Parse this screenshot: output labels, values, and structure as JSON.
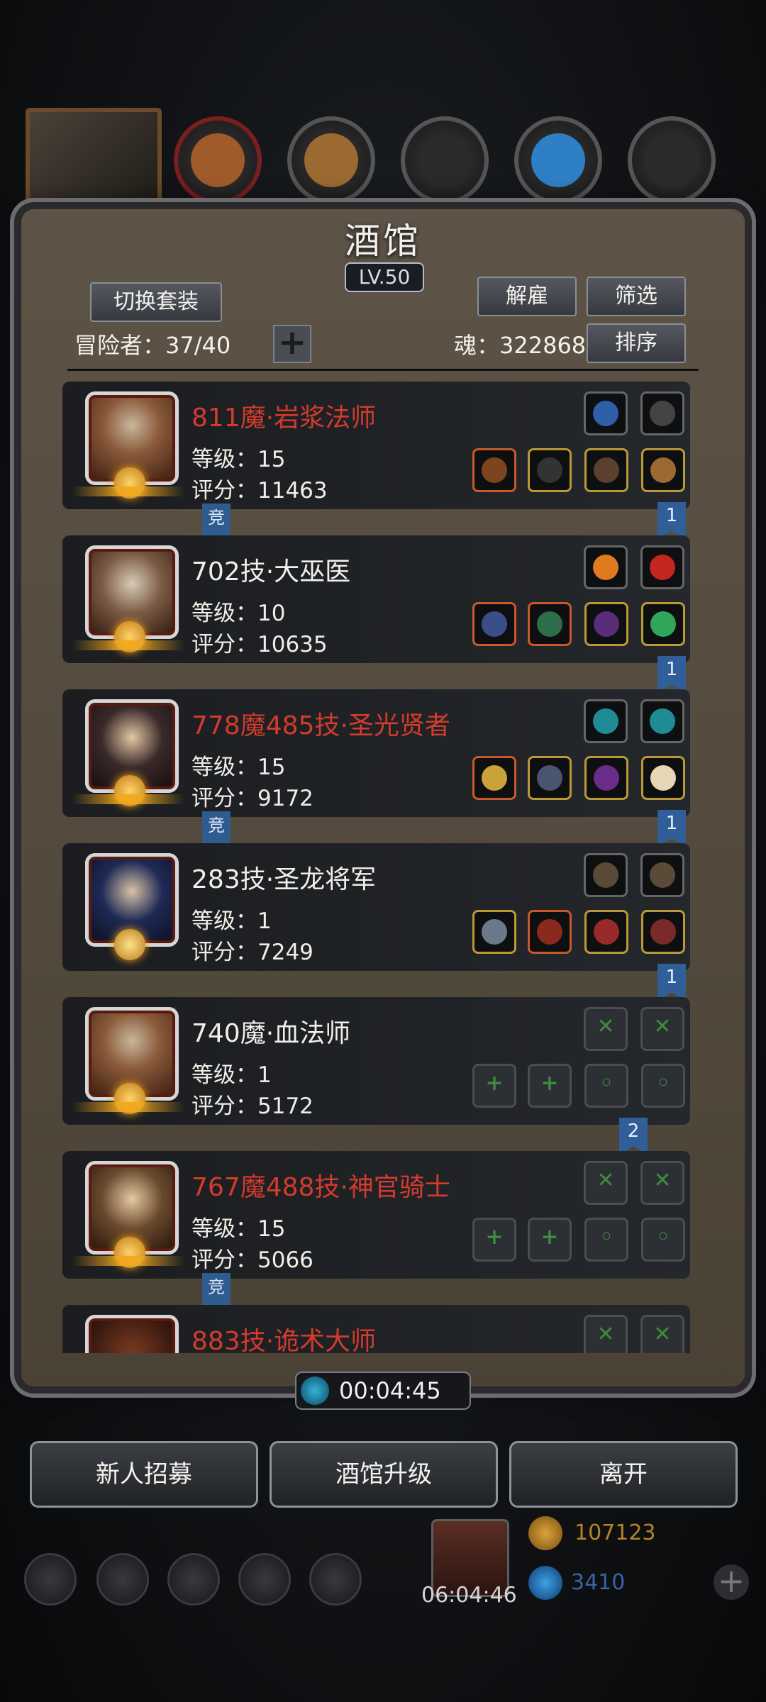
{
  "header": {
    "title": "酒馆",
    "level": "LV.50"
  },
  "toolbar": {
    "switch_outfit": "切换套装",
    "dismiss": "解雇",
    "filter": "筛选",
    "sort": "排序",
    "adventurers_label": "冒险者：37/40",
    "soul_label": "魂：322868"
  },
  "adventurers": [
    {
      "name": "811魔·岩浆法师",
      "name_color": "red",
      "level": "等级：15",
      "score": "评分：11463",
      "tag": "竞",
      "rank": "1"
    },
    {
      "name": "702技·大巫医",
      "name_color": "white",
      "level": "等级：10",
      "score": "评分：10635",
      "tag": "",
      "rank": "1"
    },
    {
      "name": "778魔485技·圣光贤者",
      "name_color": "red",
      "level": "等级：15",
      "score": "评分：9172",
      "tag": "竞",
      "rank": "1"
    },
    {
      "name": "283技·圣龙将军",
      "name_color": "white",
      "level": "等级：1",
      "score": "评分：7249",
      "tag": "",
      "rank": "1"
    },
    {
      "name": "740魔·血法师",
      "name_color": "white",
      "level": "等级：1",
      "score": "评分：5172",
      "tag": "",
      "rank": "2"
    },
    {
      "name": "767魔488技·神官骑士",
      "name_color": "red",
      "level": "等级：15",
      "score": "评分：5066",
      "tag": "竞",
      "rank": ""
    },
    {
      "name": "883技·诡术大师",
      "name_color": "red",
      "level": "",
      "score": "",
      "tag": "",
      "rank": ""
    }
  ],
  "timer": "00:04:45",
  "actions": {
    "recruit": "新人招募",
    "upgrade": "酒馆升级",
    "leave": "离开"
  },
  "resources": {
    "gold": "107123",
    "gems": "3410",
    "gift_timer": "06:04:46"
  },
  "colors": {
    "red_name": "#d33b2d",
    "accent_gold": "#f2a91e",
    "tag_blue": "#2f5e98"
  }
}
